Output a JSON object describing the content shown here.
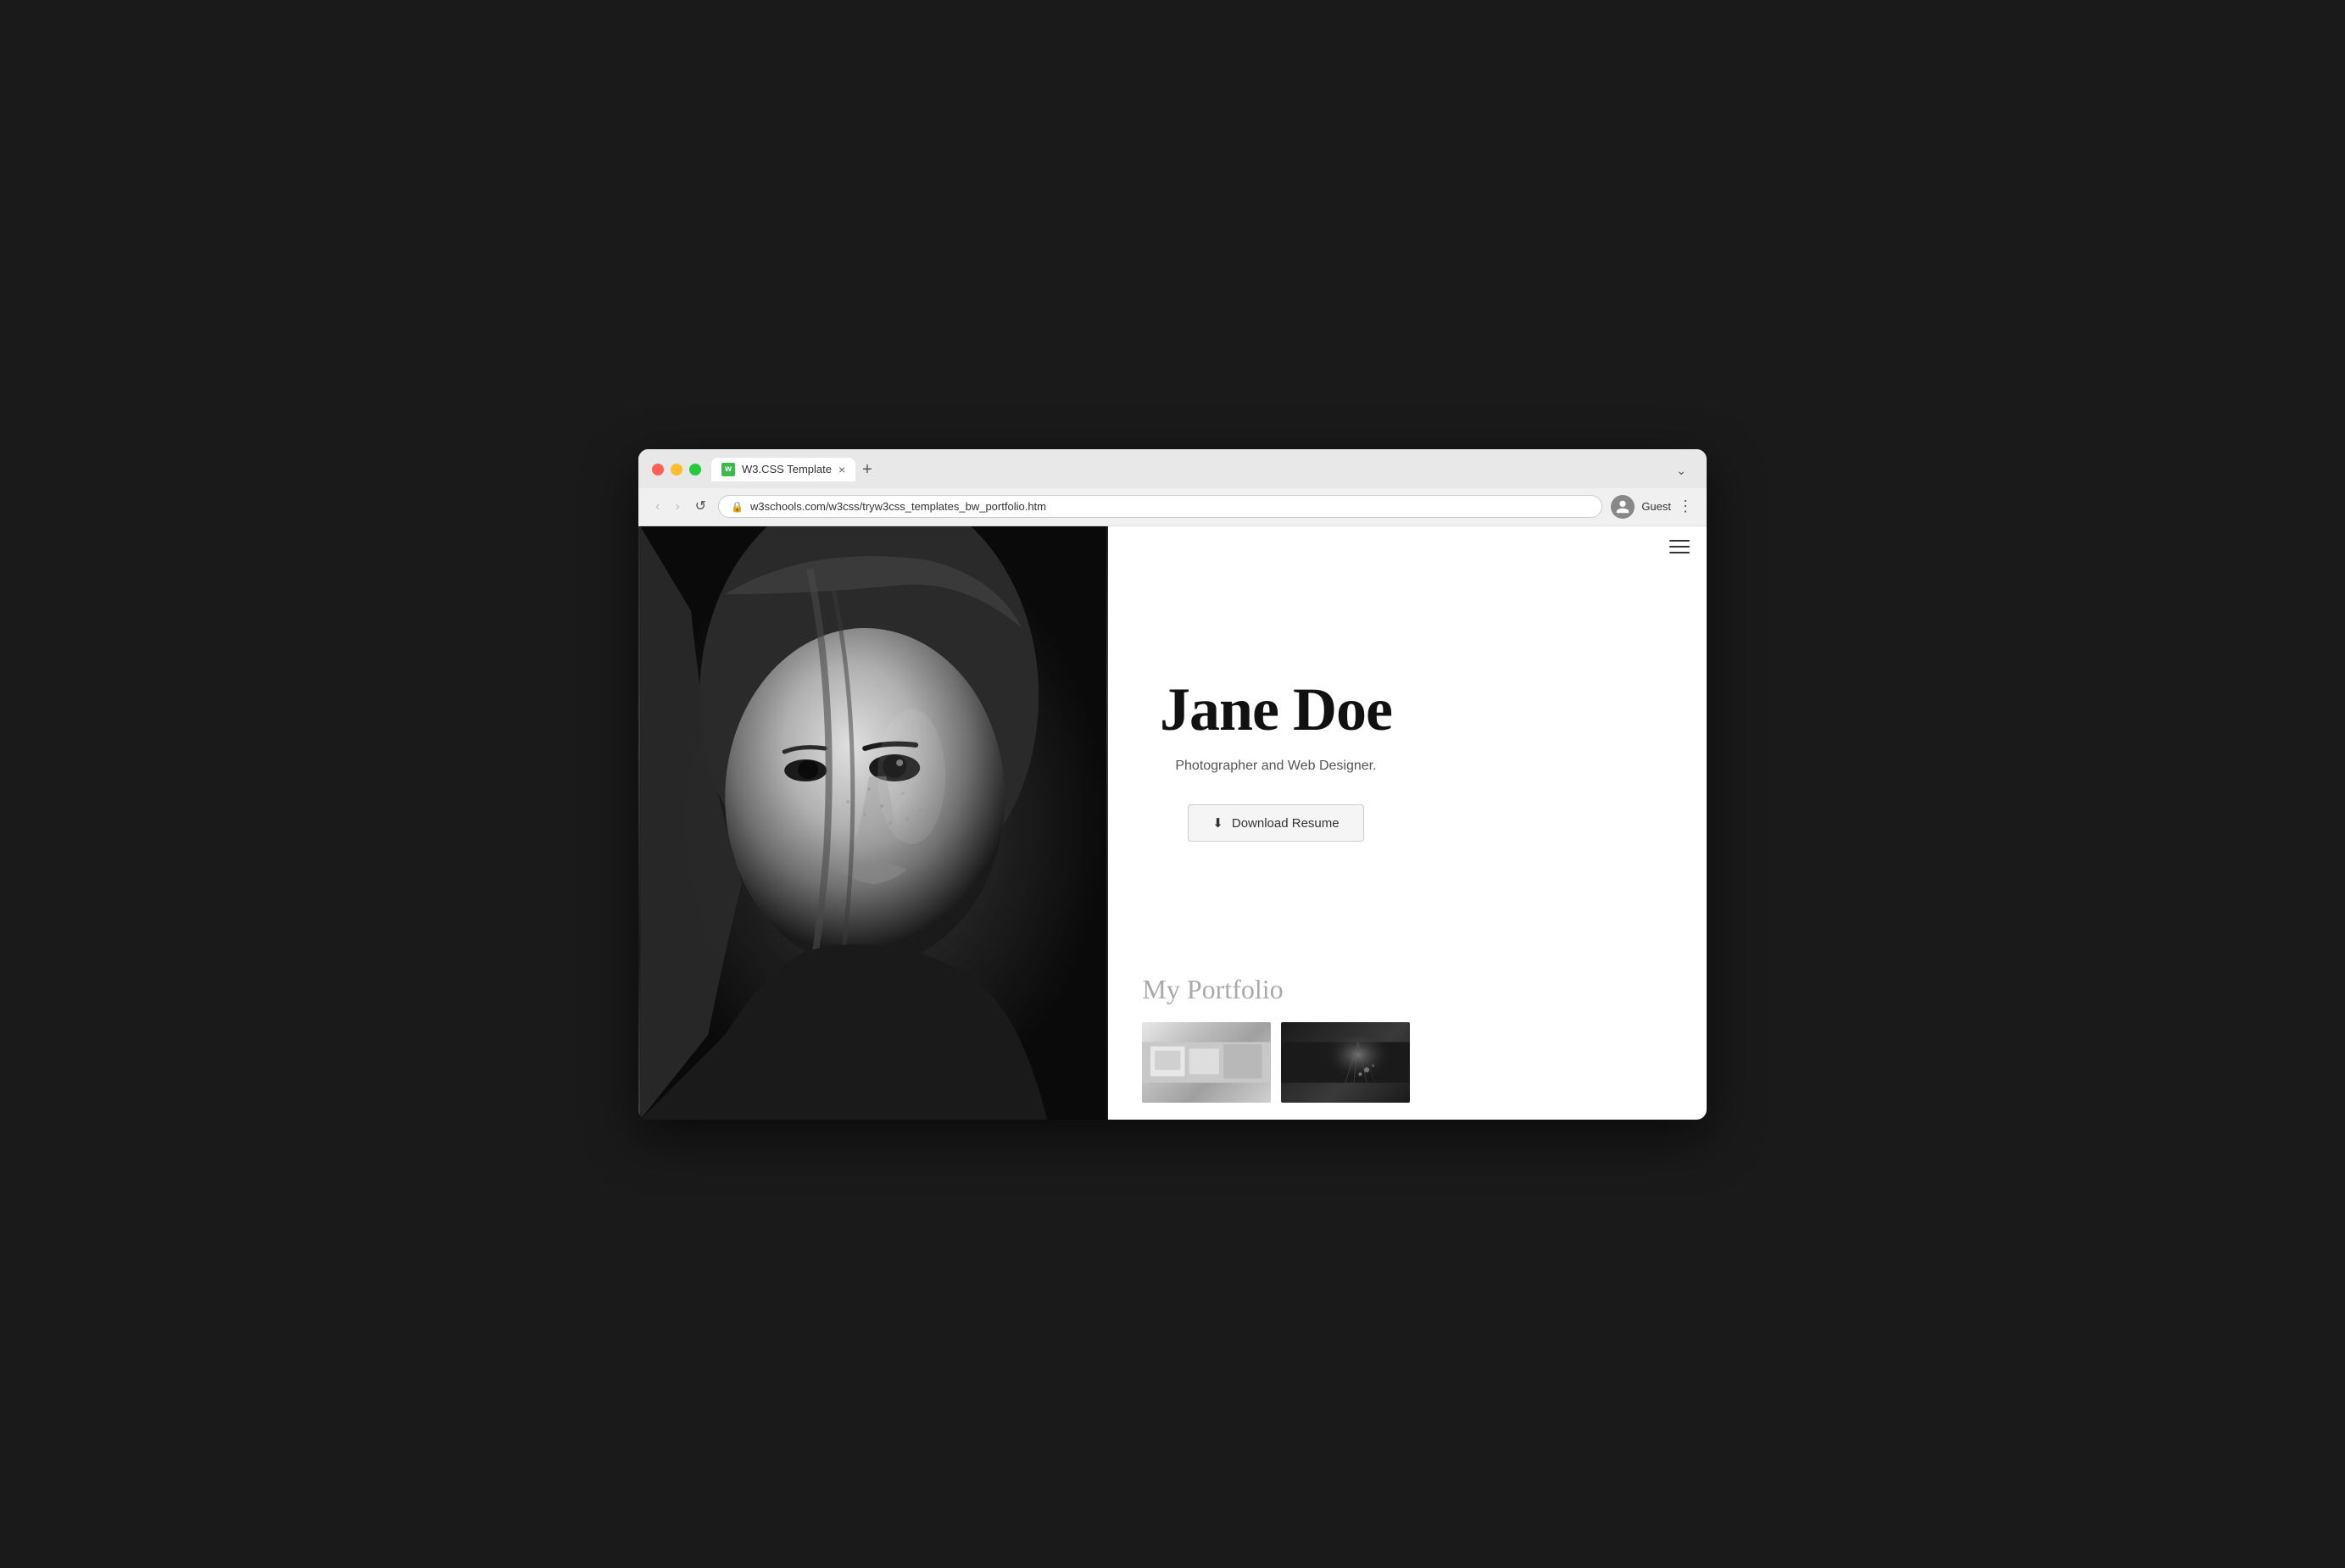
{
  "browser": {
    "tab_label": "W3.CSS Template",
    "tab_favicon": "w",
    "tab_close": "×",
    "tab_new": "+",
    "tab_dropdown": "⌄",
    "nav_back": "‹",
    "nav_forward": "›",
    "nav_reload": "↺",
    "url": "w3schools.com/w3css/tryw3css_templates_bw_portfolio.htm",
    "user_label": "Guest",
    "more_icon": "⋮"
  },
  "page": {
    "hamburger_label": "menu",
    "hero": {
      "name": "Jane Doe",
      "subtitle": "Photographer and Web Designer.",
      "download_btn": "Download Resume"
    },
    "portfolio": {
      "title": "My Portfolio"
    }
  }
}
